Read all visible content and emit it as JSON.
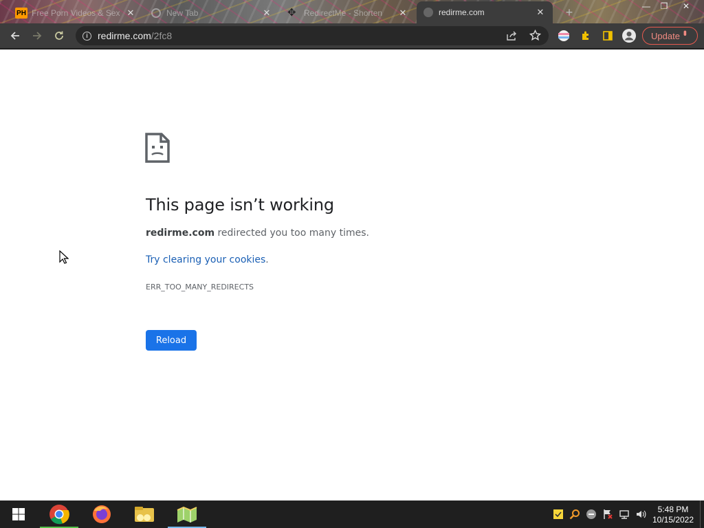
{
  "browser": {
    "tabs": [
      {
        "title": "Free Porn Videos & Sex",
        "favicon": "ph-icon",
        "active": false
      },
      {
        "title": "New Tab",
        "favicon": "globe-icon",
        "active": false
      },
      {
        "title": "RedirectMe - Shorten",
        "favicon": "move-icon",
        "active": false
      },
      {
        "title": "redirme.com",
        "favicon": "page-icon",
        "active": true
      }
    ],
    "tab_close_glyph": "✕",
    "new_tab_glyph": "+",
    "window_controls": {
      "minimize": "—",
      "restore": "❐",
      "close": "✕"
    },
    "address_bar": {
      "host": "redirme.com",
      "path": "/2fc8"
    },
    "update_label": "Update",
    "menu_glyph": "⋮",
    "colors": {
      "toolbar": "#3c3c3c",
      "omnibox": "#282828",
      "update_accent": "#f28b82"
    }
  },
  "error_page": {
    "title": "This page isn’t working",
    "host": "redirme.com",
    "description": " redirected you too many times.",
    "suggestion_link": "Try clearing your cookies",
    "suggestion_end": ".",
    "error_code": "ERR_TOO_MANY_REDIRECTS",
    "reload_label": "Reload",
    "colors": {
      "button": "#1a73e8",
      "link": "#1a5fb4",
      "title": "#202124"
    }
  },
  "taskbar": {
    "apps": [
      "start-button",
      "chrome-icon",
      "firefox-icon",
      "file-explorer-icon",
      "maps-icon"
    ],
    "clock": {
      "time": "5:48 PM",
      "date": "10/15/2022"
    }
  }
}
